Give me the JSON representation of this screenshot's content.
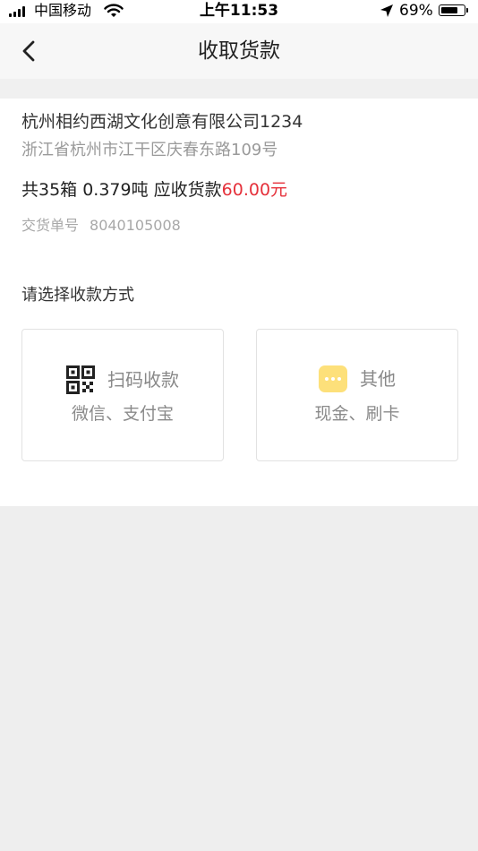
{
  "status_bar": {
    "carrier": "中国移动",
    "time": "上午11:53",
    "battery": "69%",
    "icons": [
      "signal-icon",
      "wifi-icon",
      "location-arrow-icon",
      "battery-icon"
    ]
  },
  "nav": {
    "title": "收取货款",
    "back_icon": "chevron-left-icon"
  },
  "info": {
    "company": "杭州相约西湖文化创意有限公司1234",
    "address": "浙江省杭州市江干区庆春东路109号",
    "summary_prefix": "共35箱 0.379吨  应收货款",
    "amount": "60.00元",
    "order_label": "交货单号",
    "order_number": "8040105008"
  },
  "payment": {
    "label": "请选择收款方式",
    "methods": [
      {
        "icon": "qr-code-icon",
        "title": "扫码收款",
        "subtitle": "微信、支付宝"
      },
      {
        "icon": "more-icon",
        "title": "其他",
        "subtitle": "现金、刷卡"
      }
    ]
  },
  "colors": {
    "amount": "#e5303a",
    "more_icon_bg": "#fde07a",
    "nav_bg": "#f7f7f7",
    "page_bg": "#eeeeee"
  }
}
